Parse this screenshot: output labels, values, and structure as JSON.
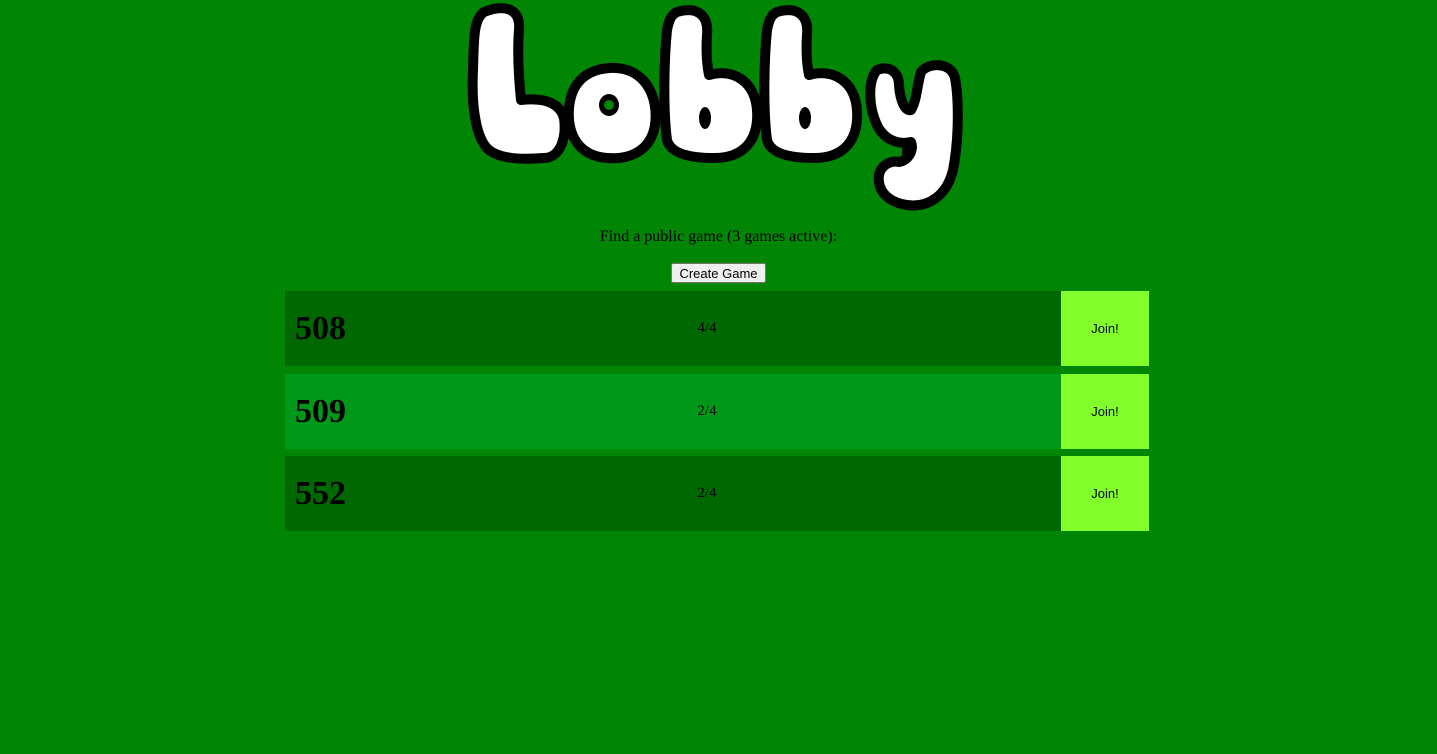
{
  "header": {
    "logo_text": "Lobby"
  },
  "lobby": {
    "subtitle": "Find a public game (3 games active):",
    "create_label": "Create Game"
  },
  "games": [
    {
      "id": "508",
      "players": "4/4",
      "join_label": "Join!"
    },
    {
      "id": "509",
      "players": "2/4",
      "join_label": "Join!"
    },
    {
      "id": "552",
      "players": "2/4",
      "join_label": "Join!"
    }
  ],
  "colors": {
    "background": "#008505",
    "row_dark": "#006800",
    "row_light": "#009818",
    "join_button": "#82ff2a"
  }
}
